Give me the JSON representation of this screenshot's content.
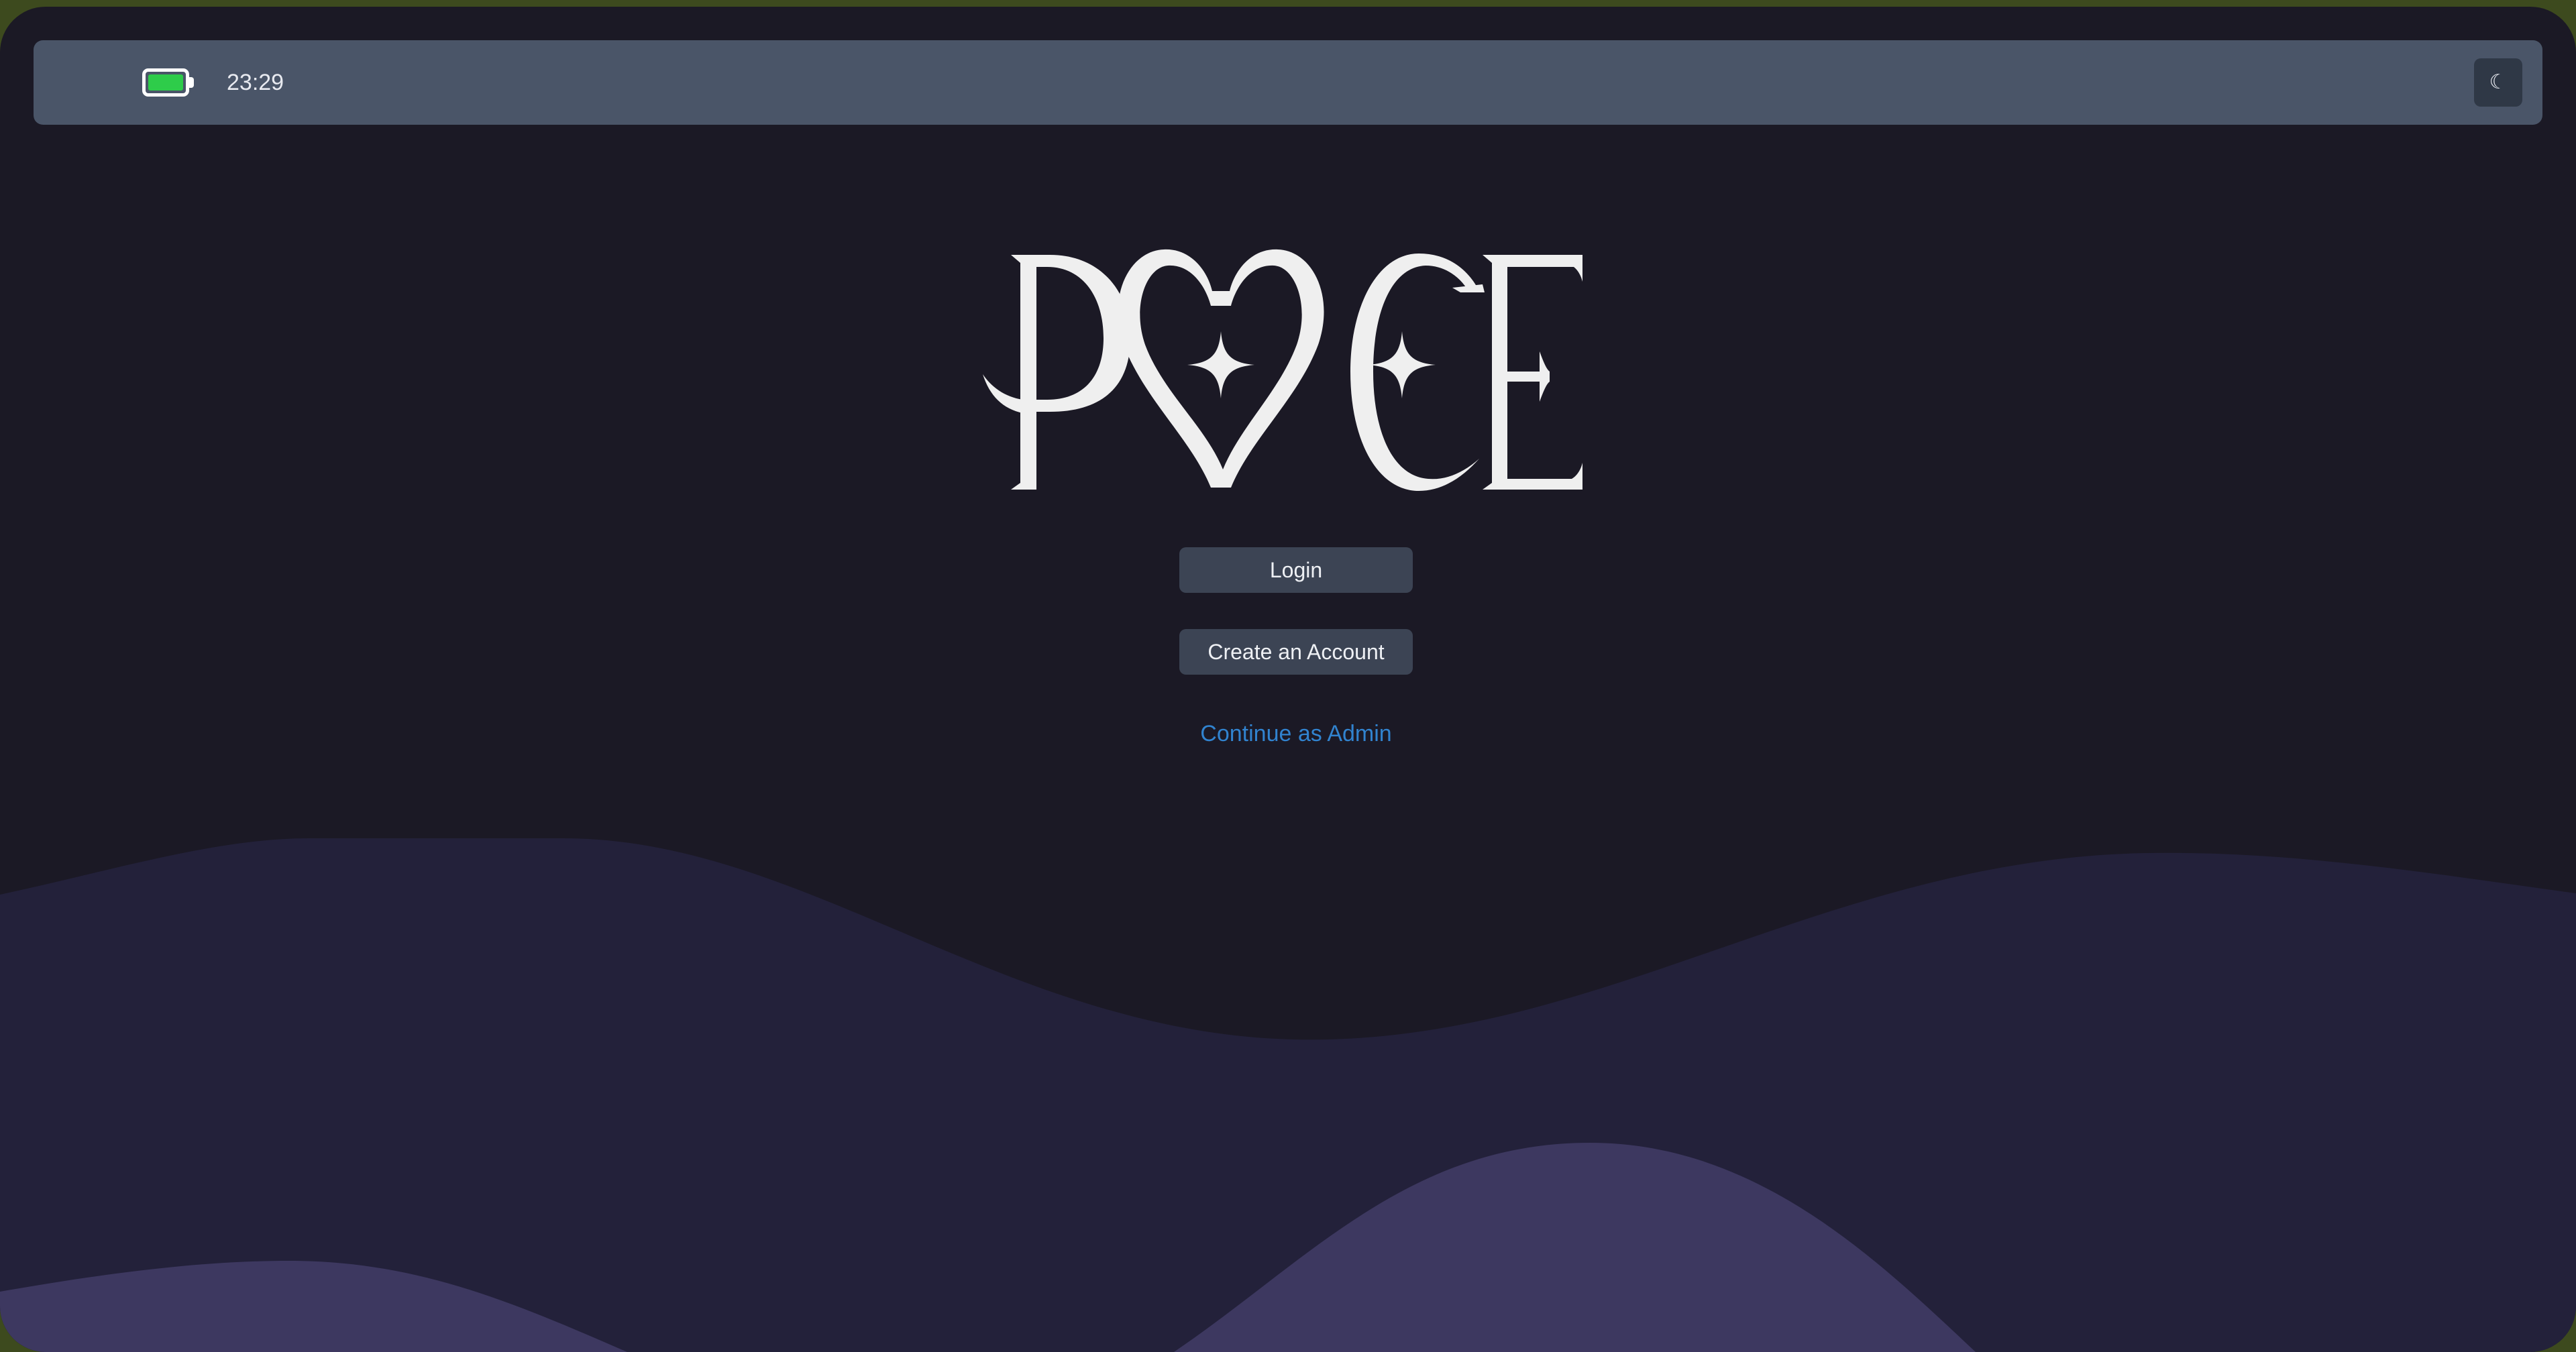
{
  "status_bar": {
    "time": "23:29",
    "battery_level": 1.0,
    "battery_icon": "battery-full-icon",
    "theme_toggle_icon": "moon-icon",
    "theme_toggle_glyph": "☾"
  },
  "logo": {
    "alt": "PVCE",
    "icon": "pvce-logo-heart-sparkle"
  },
  "auth": {
    "login_label": "Login",
    "create_account_label": "Create an Account",
    "admin_link_label": "Continue as Admin"
  },
  "colors": {
    "accent_link": "#3183cf",
    "status_bar": "#4a5568",
    "button": "#3c4454",
    "background": "#1b1925",
    "wave_back": "#23213a",
    "wave_front": "#3d3860",
    "battery_fill": "#2ecc4a",
    "frame": "#3d4a1e"
  }
}
